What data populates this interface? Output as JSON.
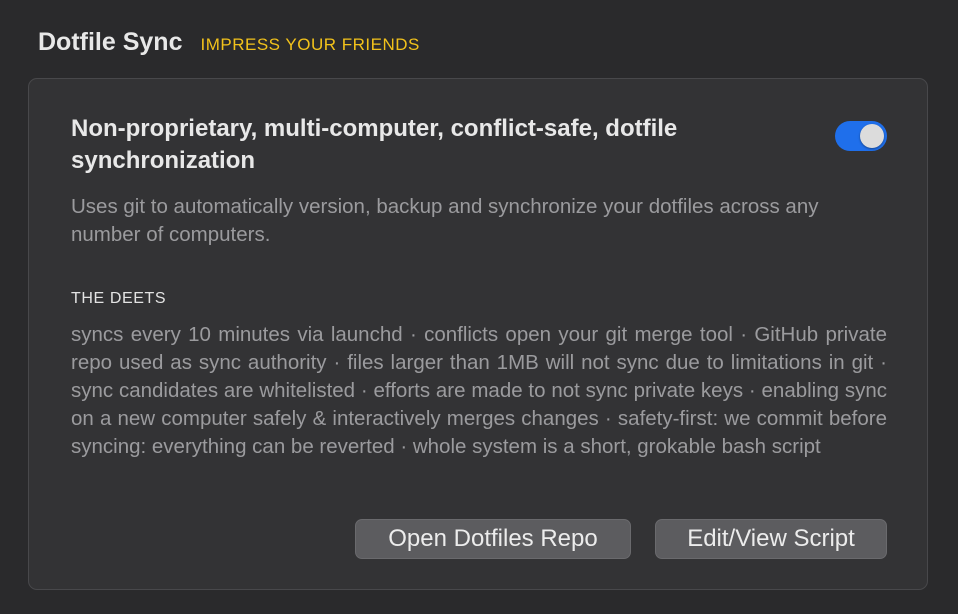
{
  "header": {
    "title": "Dotfile Sync",
    "tagline": "IMPRESS YOUR FRIENDS"
  },
  "feature": {
    "title": "Non-proprietary, multi-computer, conflict-safe, dotfile synchronization",
    "description": "Uses git to automatically version, backup and synchronize your dotfiles across any number of computers.",
    "toggle_enabled": true,
    "toggle_color": "#1f6feb"
  },
  "deets": {
    "heading": "THE DEETS",
    "text": "syncs every 10 minutes via launchd · conflicts open your git merge tool  · GitHub private repo used as sync authority  · files larger than 1MB will not sync due to limitations in git  · sync candidates are whitelisted  · efforts are made to not sync private keys · enabling sync on a new computer safely & interactively merges changes · safety-first: we commit before syncing: everything can be reverted · whole system is a short, grokable bash script"
  },
  "buttons": {
    "open_repo_label": "Open Dotfiles Repo",
    "edit_script_label": "Edit/View Script"
  },
  "colors": {
    "accent": "#f2c21b",
    "background": "#2a2a2c",
    "card": "#333335"
  }
}
